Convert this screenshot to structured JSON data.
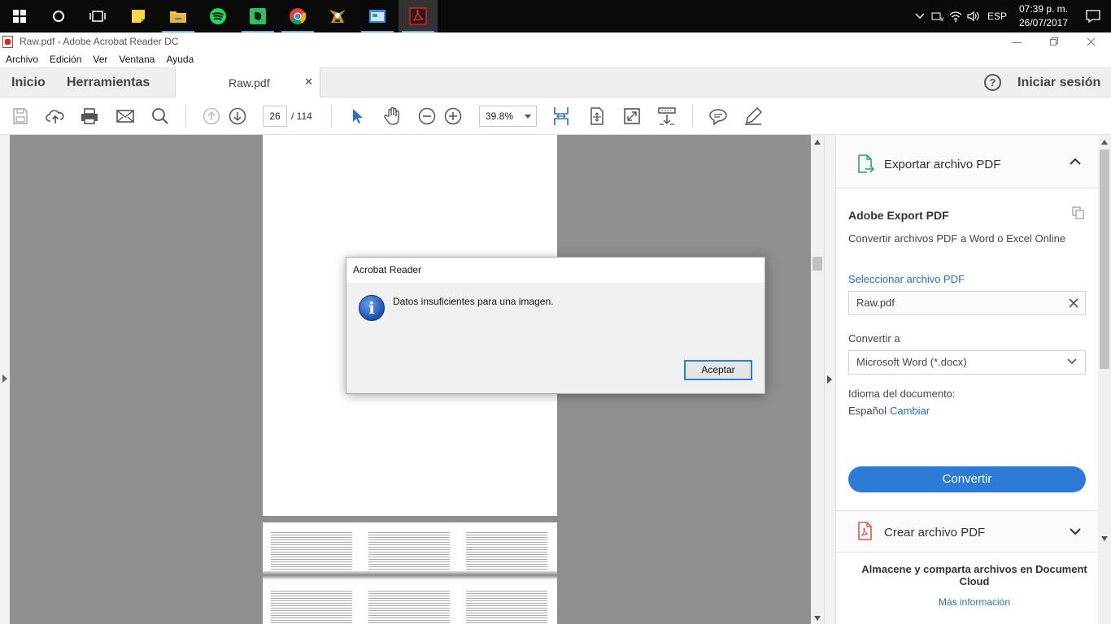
{
  "taskbar": {
    "apps": [
      "start",
      "cortana",
      "task-view",
      "sticky-notes",
      "file-explorer",
      "spotify",
      "evernote",
      "chrome",
      "game",
      "app-window",
      "acrobat-reader"
    ],
    "language": "ESP",
    "time": "07:39 p. m.",
    "date": "26/07/2017"
  },
  "window": {
    "title": "Raw.pdf - Adobe Acrobat Reader DC"
  },
  "menu": [
    "Archivo",
    "Edición",
    "Ver",
    "Ventana",
    "Ayuda"
  ],
  "tabs": {
    "home": "Inicio",
    "tools": "Herramientas",
    "document": "Raw.pdf",
    "help": "?",
    "signin": "Iniciar sesión"
  },
  "toolbar": {
    "page_current": "26",
    "page_total": "/  114",
    "zoom": "39.8%"
  },
  "right_pane": {
    "export_title": "Exportar archivo PDF",
    "service_title": "Adobe Export PDF",
    "service_desc": "Convertir archivos PDF a Word o Excel Online",
    "select_link": "Seleccionar archivo PDF",
    "selected_file": "Raw.pdf",
    "convert_to_label": "Convertir a",
    "convert_to_value": "Microsoft Word (*.docx)",
    "doc_lang_label": "Idioma del documento:",
    "doc_lang_value": "Español",
    "change_link": "Cambiar",
    "convert_button": "Convertir",
    "create_title": "Crear archivo PDF",
    "cloud_text": "Almacene y comparta archivos en Document Cloud",
    "more_info": "Más información"
  },
  "dialog": {
    "title": "Acrobat Reader",
    "message": "Datos insuficientes para una imagen.",
    "ok_button": "Aceptar"
  },
  "colors": {
    "accent": "#2d7bd6",
    "link": "#2b6fbe",
    "acrobat_red": "#d22222"
  }
}
